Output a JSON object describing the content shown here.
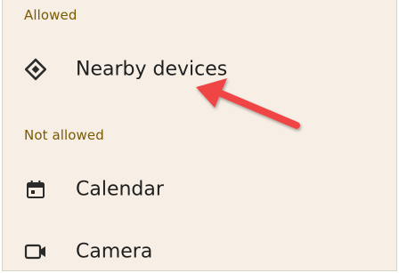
{
  "sections": {
    "allowed": {
      "header": "Allowed",
      "items": [
        {
          "label": "Nearby devices",
          "icon": "nearby-devices-icon"
        }
      ]
    },
    "not_allowed": {
      "header": "Not allowed",
      "items": [
        {
          "label": "Calendar",
          "icon": "calendar-icon"
        },
        {
          "label": "Camera",
          "icon": "camera-icon"
        }
      ]
    }
  },
  "colors": {
    "background": "#f7efe5",
    "section_header": "#7a5a00",
    "text": "#1f1f1f",
    "icon": "#2b2b2b",
    "annotation_arrow": "#ef4444"
  }
}
